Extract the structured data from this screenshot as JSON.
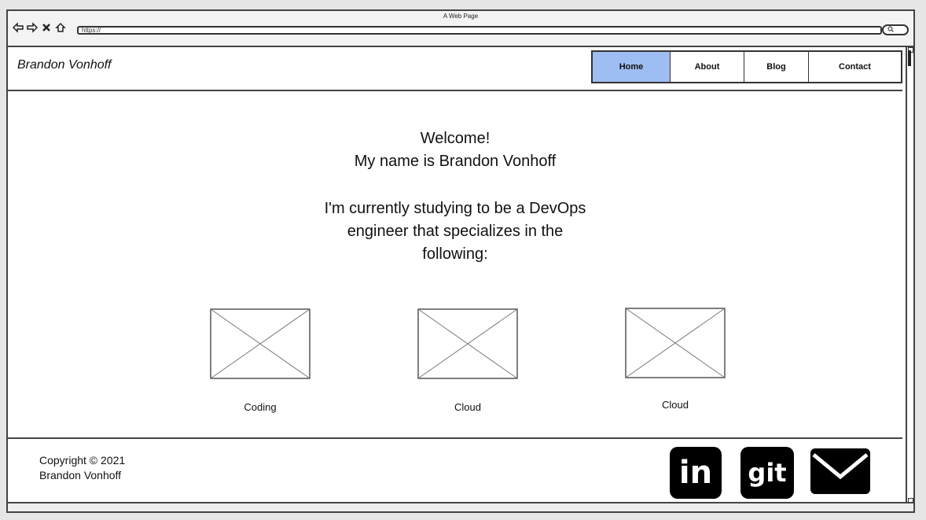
{
  "window": {
    "title": "A Web Page",
    "url": "https://"
  },
  "header": {
    "brand": "Brandon Vonhoff",
    "tabs": [
      {
        "label": "Home",
        "active": true
      },
      {
        "label": "About",
        "active": false
      },
      {
        "label": "Blog",
        "active": false
      },
      {
        "label": "Contact",
        "active": false
      }
    ]
  },
  "main": {
    "welcome": "Welcome!",
    "name_line": "My name is Brandon Vonhoff",
    "study_lines": [
      "I'm currently studying to be a DevOps",
      "engineer that specializes in the",
      "following:"
    ],
    "tiles": [
      {
        "label": "Coding",
        "icon": "image-placeholder-icon"
      },
      {
        "label": "Cloud",
        "icon": "image-placeholder-icon"
      },
      {
        "label": "Cloud",
        "icon": "image-placeholder-icon"
      }
    ]
  },
  "footer": {
    "copyright_line1": "Copyright © 2021",
    "copyright_line2": "Brandon Vonhoff",
    "social": [
      {
        "name": "linkedin-icon",
        "text": "in"
      },
      {
        "name": "git-icon",
        "text": "git"
      },
      {
        "name": "email-icon",
        "text": ""
      }
    ]
  },
  "colors": {
    "active_tab": "#9dbdf3",
    "border": "#444444"
  }
}
